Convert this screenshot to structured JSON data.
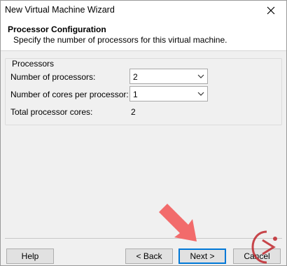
{
  "window": {
    "title": "New Virtual Machine Wizard"
  },
  "header": {
    "title": "Processor Configuration",
    "subtitle": "Specify the number of processors for this virtual machine."
  },
  "processors": {
    "legend": "Processors",
    "num_processors_label": "Number of processors:",
    "num_processors_value": "2",
    "cores_label": "Number of cores per processor:",
    "cores_value": "1",
    "total_label": "Total processor cores:",
    "total_value": "2"
  },
  "buttons": {
    "help": "Help",
    "back": "< Back",
    "next": "Next >",
    "cancel": "Cancel"
  },
  "icons": {
    "close": "close-icon",
    "dropdown": "chevron-down-icon",
    "annotation_arrow": "red-arrow-annotation",
    "watermark": "watermark-logo"
  },
  "colors": {
    "annotation_arrow": "#f26b6b",
    "primary_border": "#0078d7",
    "watermark": "#c0272d"
  }
}
